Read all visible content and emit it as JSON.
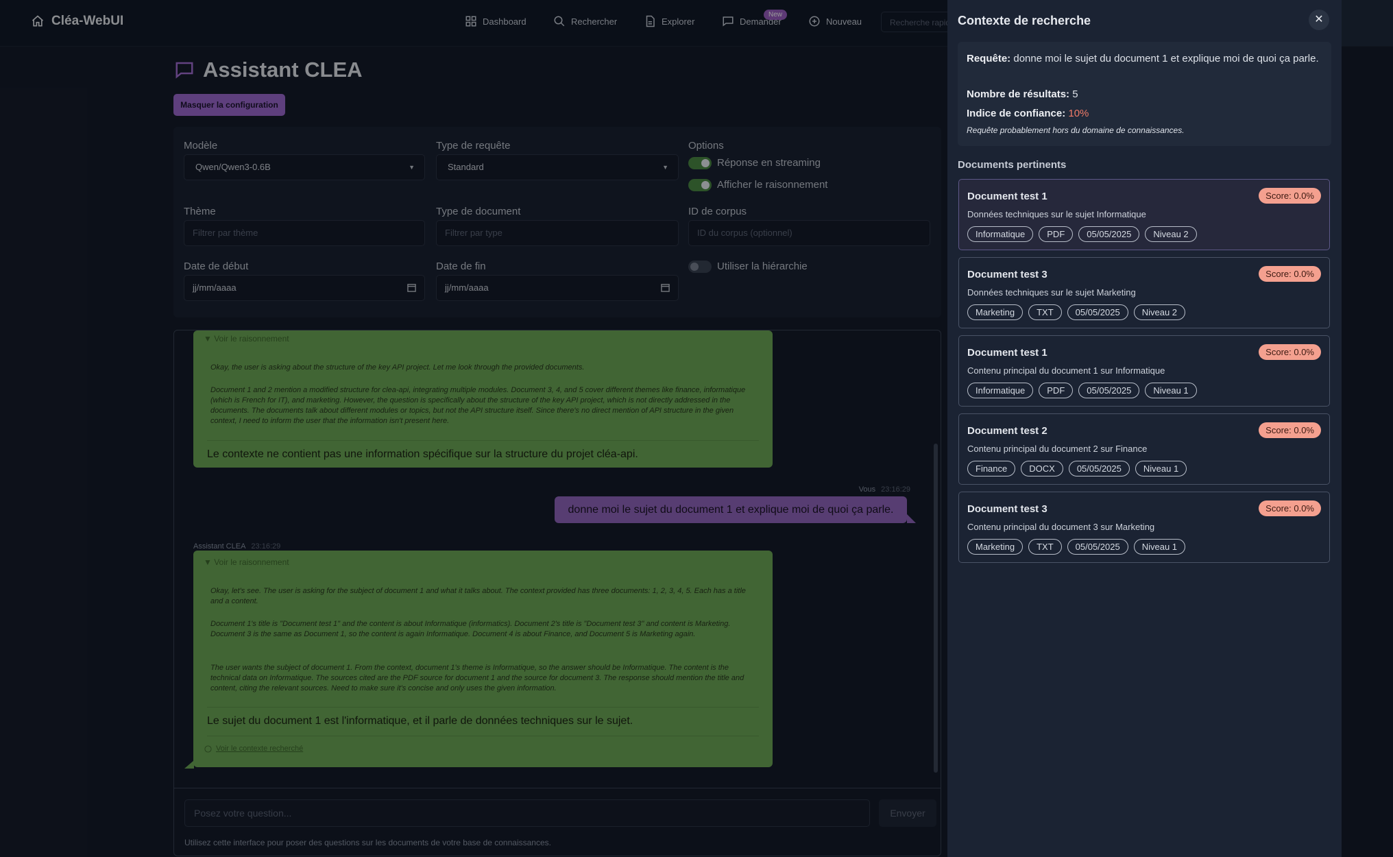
{
  "nav": {
    "brand": "Cléa-WebUI",
    "items": [
      "Dashboard",
      "Rechercher",
      "Explorer",
      "Demander",
      "Nouveau"
    ],
    "new_badge": "New",
    "quick_search_placeholder": "Recherche rapide"
  },
  "page": {
    "title": "Assistant CLEA",
    "toggle_config": "Masquer la configuration"
  },
  "config": {
    "model_label": "Modèle",
    "model_value": "Qwen/Qwen3-0.6B",
    "query_type_label": "Type de requête",
    "query_type_value": "Standard",
    "options_label": "Options",
    "opt_streaming": "Réponse en streaming",
    "opt_reasoning": "Afficher le raisonnement",
    "theme_label": "Thème",
    "theme_placeholder": "Filtrer par thème",
    "doctype_label": "Type de document",
    "doctype_placeholder": "Filtrer par type",
    "corpus_label": "ID de corpus",
    "corpus_placeholder": "ID du corpus (optionnel)",
    "start_label": "Date de début",
    "start_placeholder": "jj/mm/aaaa",
    "end_label": "Date de fin",
    "end_placeholder": "jj/mm/aaaa",
    "hierarchy_label": "Utiliser la hiérarchie"
  },
  "chat": {
    "msg1": {
      "toggle": "▼ Voir le raisonnement",
      "think_p1": "Okay, the user is asking about the structure of the key API project. Let me look through the provided documents.",
      "think_p2": "Document 1 and 2 mention a modified structure for clea-api, integrating multiple modules. Document 3, 4, and 5 cover different themes like finance, informatique (which is French for IT), and marketing. However, the question is specifically about the structure of the key API project, which is not directly addressed in the documents. The documents talk about different modules or topics, but not the API structure itself. Since there's no direct mention of API structure in the given context, I need to inform the user that the information isn't present here.",
      "answer": "Le contexte ne contient pas une information spécifique sur la structure du projet cléa-api."
    },
    "user_msg": {
      "author": "Vous",
      "time": "23:16:29",
      "text": "donne moi le sujet du document 1 et explique moi de quoi ça parle."
    },
    "msg2": {
      "author": "Assistant CLEA",
      "time": "23:16:29",
      "toggle": "▼ Voir le raisonnement",
      "think_p1": "Okay, let's see. The user is asking for the subject of document 1 and what it talks about. The context provided has three documents: 1, 2, 3, 4, 5. Each has a title and a content.",
      "think_p2": "Document 1's title is \"Document test 1\" and the content is about Informatique (informatics). Document 2's title is \"Document test 3\" and content is Marketing. Document 3 is the same as Document 1, so the content is again Informatique. Document 4 is about Finance, and Document 5 is Marketing again.",
      "think_p3": "The user wants the subject of document 1. From the context, document 1's theme is Informatique, so the answer should be Informatique. The content is the technical data on Informatique. The sources cited are the PDF source for document 1 and the source for document 3. The response should mention the title and content, citing the relevant sources. Need to make sure it's concise and only uses the given information.",
      "answer": "Le sujet du document 1 est l'informatique, et il parle de données techniques sur le sujet.",
      "context_link": "Voir le contexte recherché"
    },
    "input_placeholder": "Posez votre question...",
    "send_label": "Envoyer",
    "hint": "Utilisez cette interface pour poser des questions sur les documents de votre base de connaissances."
  },
  "panel": {
    "title": "Contexte de recherche",
    "close": "✕",
    "query_label": "Requête:",
    "query_text": "donne moi le sujet du document 1 et explique moi de quoi ça parle.",
    "results_label": "Nombre de résultats:",
    "results_value": "5",
    "confidence_label": "Indice de confiance:",
    "confidence_value": "10%",
    "note": "Requête probablement hors du domaine de connaissances.",
    "docs_heading": "Documents pertinents",
    "docs": [
      {
        "title": "Document test 1",
        "score": "Score: 0.0%",
        "desc": "Données techniques sur le sujet Informatique",
        "tags": [
          "Informatique",
          "PDF",
          "05/05/2025",
          "Niveau 2"
        ]
      },
      {
        "title": "Document test 3",
        "score": "Score: 0.0%",
        "desc": "Données techniques sur le sujet Marketing",
        "tags": [
          "Marketing",
          "TXT",
          "05/05/2025",
          "Niveau 2"
        ]
      },
      {
        "title": "Document test 1",
        "score": "Score: 0.0%",
        "desc": "Contenu principal du document 1 sur Informatique",
        "tags": [
          "Informatique",
          "PDF",
          "05/05/2025",
          "Niveau 1"
        ]
      },
      {
        "title": "Document test 2",
        "score": "Score: 0.0%",
        "desc": "Contenu principal du document 2 sur Finance",
        "tags": [
          "Finance",
          "DOCX",
          "05/05/2025",
          "Niveau 1"
        ]
      },
      {
        "title": "Document test 3",
        "score": "Score: 0.0%",
        "desc": "Contenu principal du document 3 sur Marketing",
        "tags": [
          "Marketing",
          "TXT",
          "05/05/2025",
          "Niveau 1"
        ]
      }
    ]
  },
  "colors": {
    "accent": "#9d6ad0",
    "assistant_bubble": "#6da857",
    "user_bubble": "#9267bf",
    "score_badge": "#f4a08f",
    "confidence": "#f07b68"
  }
}
